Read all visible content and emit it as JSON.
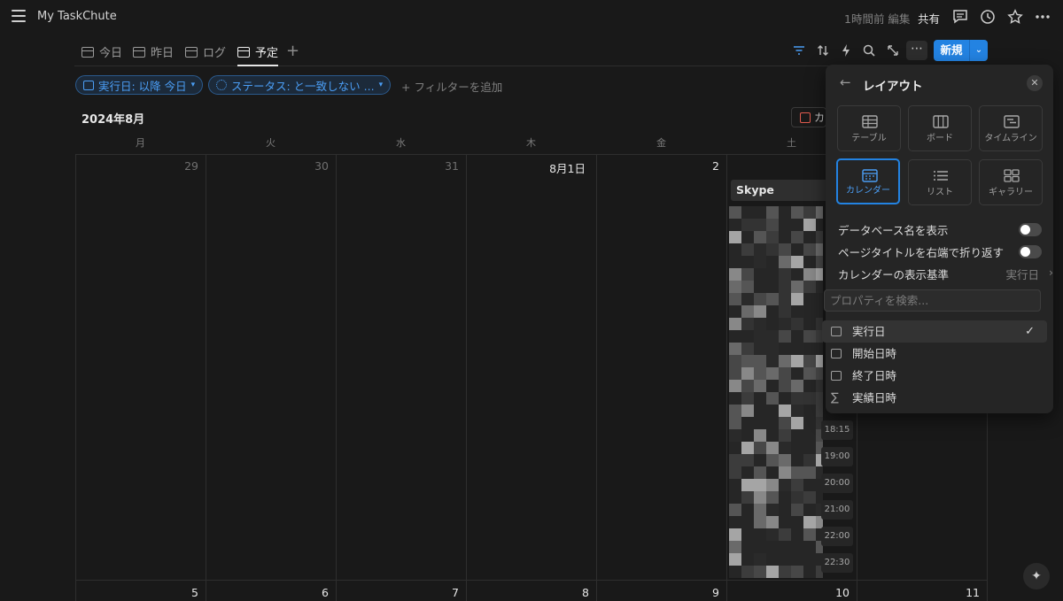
{
  "app": {
    "title": "My TaskChute"
  },
  "header": {
    "edited": "1時間前 編集",
    "share": "共有"
  },
  "tabs": [
    {
      "label": "今日"
    },
    {
      "label": "昨日"
    },
    {
      "label": "ログ"
    },
    {
      "label": "予定"
    }
  ],
  "toolbar": {
    "more": "⋯",
    "new_label": "新規",
    "new_caret": "⌄"
  },
  "filters": {
    "chip1": "実行日: 以降 今日",
    "chip2": "ステータス: と一致しない ...",
    "add": "フィルターを追加"
  },
  "calendar": {
    "month_label": "2024年8月",
    "calendar_button_label": "カ",
    "weekdays": [
      "月",
      "火",
      "水",
      "木",
      "金",
      "土"
    ],
    "week1": [
      "29",
      "30",
      "31",
      "8月1日",
      "2"
    ],
    "week2": [
      "5",
      "6",
      "7",
      "8",
      "9",
      "10",
      "11"
    ],
    "event": {
      "title": "Skype"
    },
    "times": [
      "18:15",
      "19:00",
      "20:00",
      "21:00",
      "22:00",
      "22:30"
    ]
  },
  "layout_panel": {
    "title": "レイアウト",
    "options": [
      {
        "label": "テーブル"
      },
      {
        "label": "ボード"
      },
      {
        "label": "タイムライン"
      },
      {
        "label": "カレンダー"
      },
      {
        "label": "リスト"
      },
      {
        "label": "ギャラリー"
      }
    ],
    "selected": "カレンダー",
    "show_db_name": "データベース名を表示",
    "wrap_titles": "ページタイトルを右端で折り返す",
    "calendar_basis": "カレンダーの表示基準",
    "calendar_basis_value": "実行日",
    "search_placeholder": "プロパティを検索...",
    "properties": [
      {
        "label": "実行日",
        "icon": "calendar-icon",
        "checked": true
      },
      {
        "label": "開始日時",
        "icon": "calendar-icon"
      },
      {
        "label": "終了日時",
        "icon": "calendar-icon"
      },
      {
        "label": "実績日時",
        "icon": "sigma-icon"
      }
    ],
    "check": "✓"
  },
  "colors": {
    "accent": "#2383e2",
    "background": "#191919",
    "panel": "#252525"
  }
}
